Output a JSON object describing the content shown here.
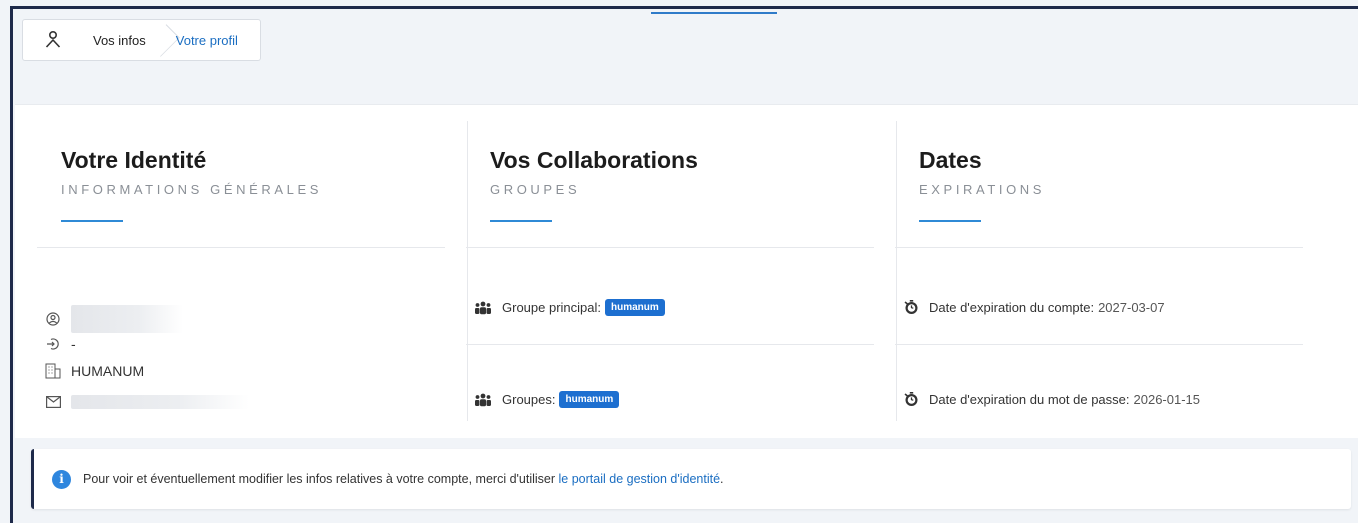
{
  "breadcrumb": {
    "icon": "user-profile-icon",
    "items": [
      "Vos infos",
      "Votre profil"
    ]
  },
  "columns": {
    "identity": {
      "title": "Votre Identité",
      "subtitle": "INFORMATIONS GÉNÉRALES",
      "fields": {
        "username_icon": "user-circle-icon",
        "login_icon": "login-icon",
        "login_value": "-",
        "organization_icon": "building-icon",
        "organization": "HUMANUM",
        "email_icon": "envelope-icon"
      }
    },
    "collaborations": {
      "title": "Vos Collaborations",
      "subtitle": "GROUPES",
      "main_group_label": "Groupe principal:",
      "main_group_badge": "humanum",
      "groups_label": "Groupes:",
      "groups_badge": "humanum"
    },
    "dates": {
      "title": "Dates",
      "subtitle": "EXPIRATIONS",
      "account_expiry_label": "Date d'expiration du compte:",
      "account_expiry_value": "2027-03-07",
      "password_expiry_label": "Date d'expiration du mot de passe:",
      "password_expiry_value": "2026-01-15"
    }
  },
  "notice": {
    "text": "Pour voir et éventuellement modifier les infos relatives à votre compte, merci d'utiliser",
    "link_text": "le portail de gestion d'identité",
    "suffix": "."
  },
  "colors": {
    "accent": "#2f8ad6",
    "badge": "#1d6fd0",
    "link": "#1b6ec2",
    "frame": "#1e2a4a"
  }
}
